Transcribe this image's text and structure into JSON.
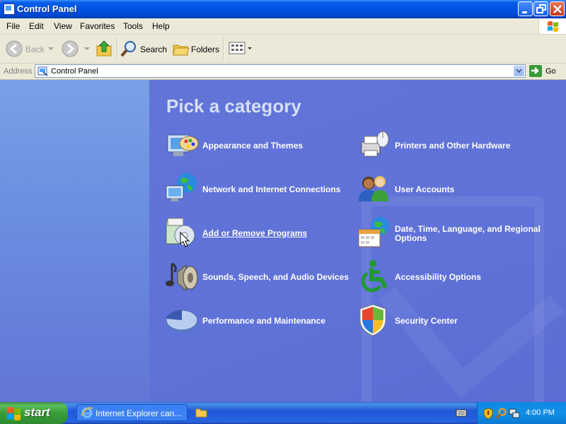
{
  "window": {
    "title": "Control Panel"
  },
  "menu": [
    "File",
    "Edit",
    "View",
    "Favorites",
    "Tools",
    "Help"
  ],
  "toolbar": {
    "back": "Back",
    "search": "Search",
    "folders": "Folders"
  },
  "address": {
    "label": "Address",
    "value": "Control Panel",
    "go": "Go"
  },
  "main": {
    "heading": "Pick a category",
    "categories": [
      {
        "label": "Appearance and Themes",
        "icon": "appearance-themes-icon"
      },
      {
        "label": "Printers and Other Hardware",
        "icon": "printer-mouse-icon"
      },
      {
        "label": "Network and Internet Connections",
        "icon": "network-globe-icon"
      },
      {
        "label": "User Accounts",
        "icon": "users-icon"
      },
      {
        "label": "Add or Remove Programs",
        "icon": "install-cd-icon"
      },
      {
        "label": "Date, Time, Language, and Regional Options",
        "icon": "calendar-globe-icon"
      },
      {
        "label": "Sounds, Speech, and Audio Devices",
        "icon": "speaker-note-icon"
      },
      {
        "label": "Accessibility Options",
        "icon": "wheelchair-icon"
      },
      {
        "label": "Performance and Maintenance",
        "icon": "pie-chart-icon"
      },
      {
        "label": "Security Center",
        "icon": "shield-icon"
      }
    ]
  },
  "taskbar": {
    "start": "start",
    "task": "Internet Explorer can...",
    "clock": "4:00 PM"
  },
  "colors": {
    "title_blue": "#0055e5",
    "pane_blue": "#6375d6",
    "start_green": "#389e38",
    "tray_blue": "#0c8ae3"
  }
}
